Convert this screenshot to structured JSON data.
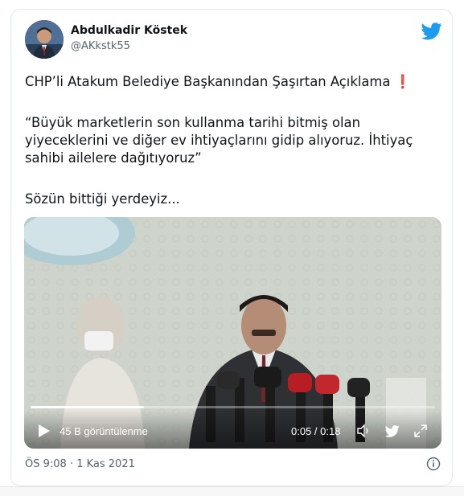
{
  "tweet": {
    "author_name": "Abdulkadir Köstek",
    "author_handle": "@AKkstk55",
    "headline": "CHP’li Atakum Belediye Başkanından Şaşırtan Açıklama",
    "headline_emoji": "❗",
    "quote_line1": "“Büyük marketlerin son kullanma tarihi bitmiş olan",
    "quote_line2": "yiyeceklerini ve diğer ev ihtiyaçlarını gidip alıyoruz. İhtiyaç",
    "quote_line3": "sahibi ailelere dağıtıyoruz”",
    "closing": "Sözün bittiği yerdeyiz...",
    "timestamp": "ÖS 9:08 · 1 Kas 2021"
  },
  "video": {
    "views": "45 B görüntülenme",
    "time": "0:05 / 0:18",
    "progress": 0.28
  },
  "icons": {
    "brand": "twitter-bird-icon",
    "play": "play-icon",
    "volume": "volume-icon",
    "fullscreen": "fullscreen-icon",
    "info": "info-icon"
  },
  "colors": {
    "brand": "#1d9bf0",
    "text": "#0f1419",
    "muted": "#536471",
    "emoji": "#e0245e"
  }
}
